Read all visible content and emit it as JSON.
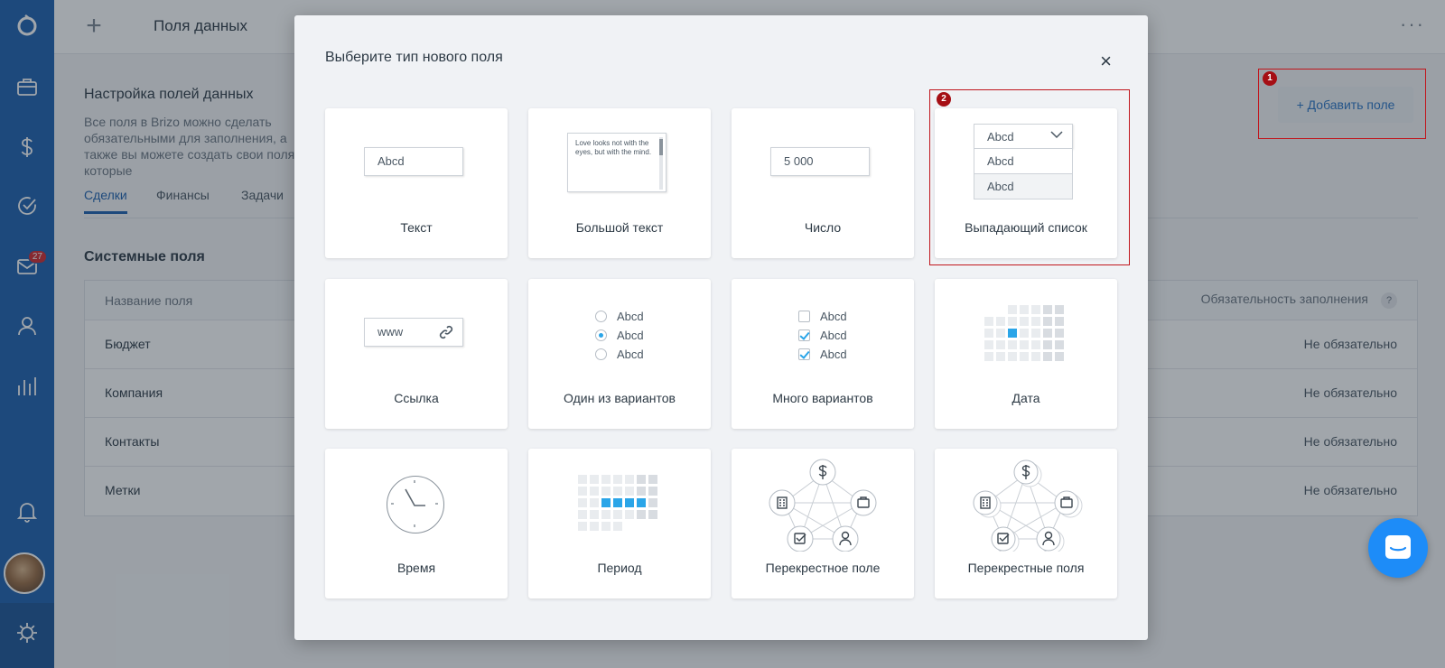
{
  "app": {
    "page_title": "Поля данных",
    "more_label": "···",
    "notifications_count": "27"
  },
  "sidebar": {
    "items": [
      "logo-icon",
      "briefcase-icon",
      "dollar-icon",
      "check-icon",
      "mail-icon",
      "user-icon",
      "chart-icon",
      "bell-icon",
      "avatar",
      "settings-icon"
    ]
  },
  "settings": {
    "title": "Настройка полей данных",
    "description": "Все поля в Brizo можно сделать обязательными для заполнения, а также вы можете создать свои поля, которые",
    "add_field_label": "+ Добавить поле",
    "tabs": [
      "Сделки",
      "Финансы",
      "Задачи"
    ],
    "system_fields_title": "Системные поля",
    "table": {
      "col_name": "Название поля",
      "col_required": "Обязательность заполнения",
      "help": "?",
      "rows": [
        {
          "name": "Бюджет",
          "required": "Не обязательно"
        },
        {
          "name": "Компания",
          "required": "Не обязательно"
        },
        {
          "name": "Контакты",
          "required": "Не обязательно"
        },
        {
          "name": "Метки",
          "required": "Не обязательно"
        }
      ]
    }
  },
  "annotations": {
    "first": "1",
    "second": "2"
  },
  "modal": {
    "title": "Выберите тип нового поля",
    "close": "×",
    "cards": [
      {
        "label": "Текст",
        "sample": "Abcd"
      },
      {
        "label": "Большой текст",
        "sample": "Love looks not with the eyes, but with the mind."
      },
      {
        "label": "Число",
        "sample": "5 000"
      },
      {
        "label": "Выпадающий список",
        "options": [
          "Abcd",
          "Abcd",
          "Abcd"
        ]
      },
      {
        "label": "Ссылка",
        "sample": "www"
      },
      {
        "label": "Один из вариантов",
        "options": [
          "Abcd",
          "Abcd",
          "Abcd"
        ]
      },
      {
        "label": "Много вариантов",
        "options": [
          "Abcd",
          "Abcd",
          "Abcd"
        ]
      },
      {
        "label": "Дата"
      },
      {
        "label": "Время"
      },
      {
        "label": "Период"
      },
      {
        "label": "Перекрестное поле"
      },
      {
        "label": "Перекрестные поля"
      }
    ]
  },
  "colors": {
    "sidebar": "#1c5fae",
    "accent": "#2aa5e8",
    "annotation": "#c0161d",
    "chat": "#1d8cf8"
  }
}
